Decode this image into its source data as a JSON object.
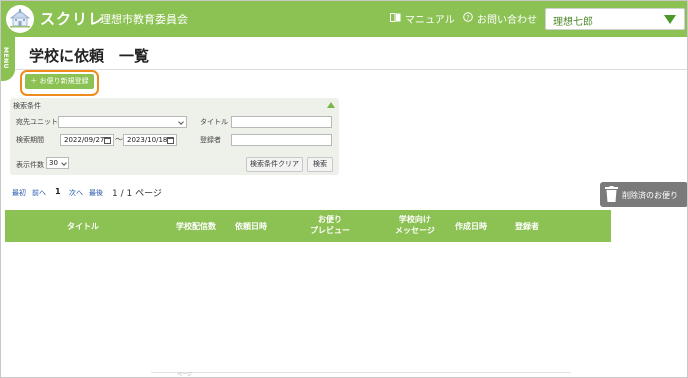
{
  "header": {
    "app_name": "スクリレ",
    "org_name": "理想市教育委員会",
    "manual_label": "マニュアル",
    "contact_label": "お問い合わせ",
    "user_select_value": "理想七郎",
    "accent_color": "#8cc153"
  },
  "menu_tab": {
    "label": "MENU"
  },
  "page": {
    "title": "学校に依頼　一覧",
    "new_button_label": "＋ お便り新規登録"
  },
  "search": {
    "title": "検索条件",
    "unit_label": "宛先ユニット",
    "unit_value": "",
    "title_label": "タイトル",
    "title_value": "",
    "period_label": "検索期間",
    "date_from": "2022/09/27",
    "date_to": "2023/10/18",
    "registrant_label": "登録者",
    "registrant_value": "",
    "count_label": "表示件数",
    "count_value": "30",
    "clear_label": "検索条件クリア",
    "search_label": "検索"
  },
  "pager": {
    "first": "最初",
    "prev": "前へ",
    "current": "1",
    "next": "次へ",
    "last": "最後",
    "info": "1 / 1 ページ"
  },
  "deleted_button_label": "削除済のお便り",
  "table": {
    "columns": [
      "タイトル",
      "学校配信数",
      "依頼日時",
      "お便り\nプレビュー",
      "学校向け\nメッセージ",
      "作成日時",
      "登録者"
    ]
  },
  "footer_fragment": "ページ"
}
